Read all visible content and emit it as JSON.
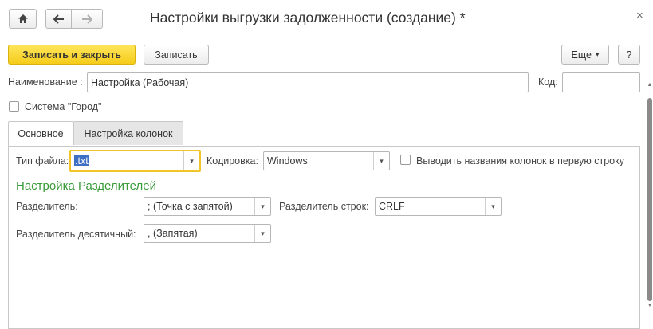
{
  "window": {
    "title": "Настройки выгрузки задолженности (создание) *",
    "close_glyph": "×"
  },
  "nav": {
    "home_icon": "home-icon",
    "back_icon": "arrow-left-icon",
    "forward_icon": "arrow-right-icon"
  },
  "toolbar": {
    "save_close_label": "Записать и закрыть",
    "save_label": "Записать",
    "more_label": "Еще",
    "more_arrow": "▾",
    "help_label": "?"
  },
  "form": {
    "name_label": "Наименование :",
    "name_value": "Настройка (Рабочая)",
    "code_label": "Код:",
    "code_value": "",
    "system_label": "Система \"Город\"",
    "system_checked": false
  },
  "tabs": [
    {
      "label": "Основное",
      "active": true
    },
    {
      "label": "Настройка колонок",
      "active": false
    }
  ],
  "main": {
    "file_type_label": "Тип файла:",
    "file_type_value": ".txt",
    "encoding_label": "Кодировка:",
    "encoding_value": "Windows",
    "header_row_label": "Выводить названия колонок в первую строку",
    "header_row_checked": false,
    "separators_group": "Настройка Разделителей",
    "separator_label": "Разделитель:",
    "separator_value": "; (Точка с запятой)",
    "line_sep_label": "Разделитель строк:",
    "line_sep_value": "CRLF",
    "decimal_sep_label": "Разделитель десятичный:",
    "decimal_sep_value": ", (Запятая)"
  },
  "dropdown_glyph": "▾",
  "colors": {
    "primary_button": "#f5cc1a",
    "group_title": "#3a9b3a",
    "focus_border": "#f3c428",
    "selection": "#3d6fc4"
  }
}
